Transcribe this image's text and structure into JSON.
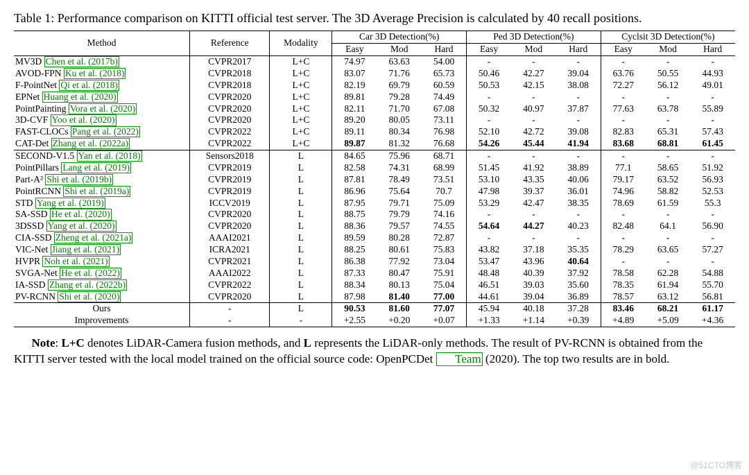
{
  "caption": "Table 1: Performance comparison on KITTI official test server. The 3D Average Precision is calculated by 40 recall positions.",
  "headers": {
    "method": "Method",
    "reference": "Reference",
    "modality": "Modality",
    "groups": [
      "Car 3D Detection(%)",
      "Ped 3D Detection(%)",
      "Cyclsit 3D Detection(%)"
    ],
    "sub": [
      "Easy",
      "Mod",
      "Hard"
    ]
  },
  "rows": [
    {
      "section": 0,
      "method": "MV3D",
      "cite": "Chen et al. (2017b)",
      "ref": "CVPR2017",
      "mod": "L+C",
      "v": [
        "74.97",
        "63.63",
        "54.00",
        "-",
        "-",
        "-",
        "-",
        "-",
        "-"
      ]
    },
    {
      "section": 0,
      "method": "AVOD-FPN",
      "cite": "Ku et al. (2018)",
      "ref": "CVPR2018",
      "mod": "L+C",
      "v": [
        "83.07",
        "71.76",
        "65.73",
        "50.46",
        "42.27",
        "39.04",
        "63.76",
        "50.55",
        "44.93"
      ]
    },
    {
      "section": 0,
      "method": "F-PointNet",
      "cite": "Qi et al. (2018)",
      "ref": "CVPR2018",
      "mod": "L+C",
      "v": [
        "82.19",
        "69.79",
        "60.59",
        "50.53",
        "42.15",
        "38.08",
        "72.27",
        "56.12",
        "49.01"
      ]
    },
    {
      "section": 0,
      "method": "EPNet",
      "cite": "Huang et al. (2020)",
      "ref": "CVPR2020",
      "mod": "L+C",
      "v": [
        "89.81",
        "79.28",
        "74.49",
        "-",
        "-",
        "-",
        "-",
        "-",
        "-"
      ]
    },
    {
      "section": 0,
      "method": "PointPainting",
      "cite": "Vora et al. (2020)",
      "ref": "CVPR2020",
      "mod": "L+C",
      "v": [
        "82.11",
        "71.70",
        "67.08",
        "50.32",
        "40.97",
        "37.87",
        "77.63",
        "63.78",
        "55.89"
      ]
    },
    {
      "section": 0,
      "method": "3D-CVF",
      "cite": "Yoo et al. (2020)",
      "ref": "CVPR2020",
      "mod": "L+C",
      "v": [
        "89.20",
        "80.05",
        "73.11",
        "-",
        "-",
        "-",
        "-",
        "-",
        "-"
      ]
    },
    {
      "section": 0,
      "method": "FAST-CLOCs",
      "cite": "Pang et al. (2022)",
      "ref": "CVPR2022",
      "mod": "L+C",
      "v": [
        "89.11",
        "80.34",
        "76.98",
        "52.10",
        "42.72",
        "39.08",
        "82.83",
        "65.31",
        "57.43"
      ]
    },
    {
      "section": 0,
      "method": "CAT-Det",
      "cite": "Zhang et al. (2022a)",
      "ref": "CVPR2022",
      "mod": "L+C",
      "v": [
        "89.87",
        "81.32",
        "76.68",
        "54.26",
        "45.44",
        "41.94",
        "83.68",
        "68.81",
        "61.45"
      ],
      "bold": [
        0,
        3,
        4,
        5,
        6,
        7,
        8
      ]
    },
    {
      "section": 1,
      "method": "SECOND-V1.5",
      "cite": "Yan et al. (2018)",
      "ref": "Sensors2018",
      "mod": "L",
      "v": [
        "84.65",
        "75.96",
        "68.71",
        "-",
        "-",
        "-",
        "-",
        "-",
        "-"
      ]
    },
    {
      "section": 1,
      "method": "PointPillars",
      "cite": "Lang et al. (2019)",
      "ref": "CVPR2019",
      "mod": "L",
      "v": [
        "82.58",
        "74.31",
        "68.99",
        "51.45",
        "41.92",
        "38.89",
        "77.1",
        "58.65",
        "51.92"
      ]
    },
    {
      "section": 1,
      "method": "Part-A²",
      "cite": "Shi et al. (2019b)",
      "ref": "CVPR2019",
      "mod": "L",
      "v": [
        "87.81",
        "78.49",
        "73.51",
        "53.10",
        "43.35",
        "40.06",
        "79.17",
        "63.52",
        "56.93"
      ]
    },
    {
      "section": 1,
      "method": "PointRCNN",
      "cite": "Shi et al. (2019a)",
      "ref": "CVPR2019",
      "mod": "L",
      "v": [
        "86.96",
        "75.64",
        "70.7",
        "47.98",
        "39.37",
        "36.01",
        "74.96",
        "58.82",
        "52.53"
      ]
    },
    {
      "section": 1,
      "method": "STD",
      "cite": "Yang et al. (2019)",
      "ref": "ICCV2019",
      "mod": "L",
      "v": [
        "87.95",
        "79.71",
        "75.09",
        "53.29",
        "42.47",
        "38.35",
        "78.69",
        "61.59",
        "55.3"
      ]
    },
    {
      "section": 1,
      "method": "SA-SSD",
      "cite": "He et al. (2020)",
      "ref": "CVPR2020",
      "mod": "L",
      "v": [
        "88.75",
        "79.79",
        "74.16",
        "-",
        "-",
        "-",
        "-",
        "-",
        "-"
      ]
    },
    {
      "section": 1,
      "method": "3DSSD",
      "cite": "Yang et al. (2020)",
      "ref": "CVPR2020",
      "mod": "L",
      "v": [
        "88.36",
        "79.57",
        "74.55",
        "54.64",
        "44.27",
        "40.23",
        "82.48",
        "64.1",
        "56.90"
      ],
      "bold": [
        3,
        4
      ]
    },
    {
      "section": 1,
      "method": "CIA-SSD",
      "cite": "Zheng et al. (2021a)",
      "ref": "AAAI2021",
      "mod": "L",
      "v": [
        "89.59",
        "80.28",
        "72.87",
        "-",
        "-",
        "-",
        "-",
        "-",
        "-"
      ]
    },
    {
      "section": 1,
      "method": "VIC-Net",
      "cite": "Jiang et al. (2021)",
      "ref": "ICRA2021",
      "mod": "L",
      "v": [
        "88.25",
        "80.61",
        "75.83",
        "43.82",
        "37.18",
        "35.35",
        "78.29",
        "63.65",
        "57.27"
      ]
    },
    {
      "section": 1,
      "method": "HVPR",
      "cite": "Noh et al. (2021)",
      "ref": "CVPR2021",
      "mod": "L",
      "v": [
        "86.38",
        "77.92",
        "73.04",
        "53.47",
        "43.96",
        "40.64",
        "-",
        "-",
        "-"
      ],
      "bold": [
        5
      ]
    },
    {
      "section": 1,
      "method": "SVGA-Net",
      "cite": "He et al. (2022)",
      "ref": "AAAI2022",
      "mod": "L",
      "v": [
        "87.33",
        "80.47",
        "75.91",
        "48.48",
        "40.39",
        "37.92",
        "78.58",
        "62.28",
        "54.88"
      ]
    },
    {
      "section": 1,
      "method": "IA-SSD",
      "cite": "Zhang et al. (2022b)",
      "ref": "CVPR2022",
      "mod": "L",
      "v": [
        "88.34",
        "80.13",
        "75.04",
        "46.51",
        "39.03",
        "35.60",
        "78.35",
        "61.94",
        "55.70"
      ]
    },
    {
      "section": 1,
      "method": "PV-RCNN",
      "cite": "Shi et al. (2020)",
      "ref": "CVPR2020",
      "mod": "L",
      "v": [
        "87.98",
        "81.40",
        "77.00",
        "44.61",
        "39.04",
        "36.89",
        "78.57",
        "63.12",
        "56.81"
      ],
      "bold": [
        1,
        2
      ]
    },
    {
      "section": 2,
      "method": "Ours",
      "ref": "-",
      "mod": "L",
      "v": [
        "90.53",
        "81.60",
        "77.07",
        "45.94",
        "40.18",
        "37.28",
        "83.46",
        "68.21",
        "61.17"
      ],
      "bold": [
        0,
        1,
        2,
        6,
        7,
        8
      ],
      "center": true
    },
    {
      "section": 2,
      "method": "Improvements",
      "ref": "-",
      "mod": "-",
      "v": [
        "+2.55",
        "+0.20",
        "+0.07",
        "+1.33",
        "+1.14",
        "+0.39",
        "+4.89",
        "+5.09",
        "+4.36"
      ],
      "center": true
    }
  ],
  "note_parts": {
    "prefix": "Note",
    "body1": ": ",
    "lc": "L+C",
    "body2": " denotes LiDAR-Camera fusion methods, and ",
    "l": "L",
    "body3": " represents the LiDAR-only methods. The result of PV-RCNN is obtained from the KITTI server tested with the local model trained on the official source code: OpenPCDet ",
    "cite": "Team",
    "year": " (2020)",
    "body4": ". The top two results are in bold."
  },
  "watermark": "@51CTO博客",
  "chart_data": {
    "type": "table",
    "title": "Performance comparison on KITTI official test server (3D AP, 40 recall positions)",
    "columns": [
      "Method",
      "Reference",
      "Modality",
      "Car-Easy",
      "Car-Mod",
      "Car-Hard",
      "Ped-Easy",
      "Ped-Mod",
      "Ped-Hard",
      "Cyc-Easy",
      "Cyc-Mod",
      "Cyc-Hard"
    ],
    "rows": [
      [
        "MV3D",
        "CVPR2017",
        "L+C",
        74.97,
        63.63,
        54.0,
        null,
        null,
        null,
        null,
        null,
        null
      ],
      [
        "AVOD-FPN",
        "CVPR2018",
        "L+C",
        83.07,
        71.76,
        65.73,
        50.46,
        42.27,
        39.04,
        63.76,
        50.55,
        44.93
      ],
      [
        "F-PointNet",
        "CVPR2018",
        "L+C",
        82.19,
        69.79,
        60.59,
        50.53,
        42.15,
        38.08,
        72.27,
        56.12,
        49.01
      ],
      [
        "EPNet",
        "CVPR2020",
        "L+C",
        89.81,
        79.28,
        74.49,
        null,
        null,
        null,
        null,
        null,
        null
      ],
      [
        "PointPainting",
        "CVPR2020",
        "L+C",
        82.11,
        71.7,
        67.08,
        50.32,
        40.97,
        37.87,
        77.63,
        63.78,
        55.89
      ],
      [
        "3D-CVF",
        "CVPR2020",
        "L+C",
        89.2,
        80.05,
        73.11,
        null,
        null,
        null,
        null,
        null,
        null
      ],
      [
        "FAST-CLOCs",
        "CVPR2022",
        "L+C",
        89.11,
        80.34,
        76.98,
        52.1,
        42.72,
        39.08,
        82.83,
        65.31,
        57.43
      ],
      [
        "CAT-Det",
        "CVPR2022",
        "L+C",
        89.87,
        81.32,
        76.68,
        54.26,
        45.44,
        41.94,
        83.68,
        68.81,
        61.45
      ],
      [
        "SECOND-V1.5",
        "Sensors2018",
        "L",
        84.65,
        75.96,
        68.71,
        null,
        null,
        null,
        null,
        null,
        null
      ],
      [
        "PointPillars",
        "CVPR2019",
        "L",
        82.58,
        74.31,
        68.99,
        51.45,
        41.92,
        38.89,
        77.1,
        58.65,
        51.92
      ],
      [
        "Part-A2",
        "CVPR2019",
        "L",
        87.81,
        78.49,
        73.51,
        53.1,
        43.35,
        40.06,
        79.17,
        63.52,
        56.93
      ],
      [
        "PointRCNN",
        "CVPR2019",
        "L",
        86.96,
        75.64,
        70.7,
        47.98,
        39.37,
        36.01,
        74.96,
        58.82,
        52.53
      ],
      [
        "STD",
        "ICCV2019",
        "L",
        87.95,
        79.71,
        75.09,
        53.29,
        42.47,
        38.35,
        78.69,
        61.59,
        55.3
      ],
      [
        "SA-SSD",
        "CVPR2020",
        "L",
        88.75,
        79.79,
        74.16,
        null,
        null,
        null,
        null,
        null,
        null
      ],
      [
        "3DSSD",
        "CVPR2020",
        "L",
        88.36,
        79.57,
        74.55,
        54.64,
        44.27,
        40.23,
        82.48,
        64.1,
        56.9
      ],
      [
        "CIA-SSD",
        "AAAI2021",
        "L",
        89.59,
        80.28,
        72.87,
        null,
        null,
        null,
        null,
        null,
        null
      ],
      [
        "VIC-Net",
        "ICRA2021",
        "L",
        88.25,
        80.61,
        75.83,
        43.82,
        37.18,
        35.35,
        78.29,
        63.65,
        57.27
      ],
      [
        "HVPR",
        "CVPR2021",
        "L",
        86.38,
        77.92,
        73.04,
        53.47,
        43.96,
        40.64,
        null,
        null,
        null
      ],
      [
        "SVGA-Net",
        "AAAI2022",
        "L",
        87.33,
        80.47,
        75.91,
        48.48,
        40.39,
        37.92,
        78.58,
        62.28,
        54.88
      ],
      [
        "IA-SSD",
        "CVPR2022",
        "L",
        88.34,
        80.13,
        75.04,
        46.51,
        39.03,
        35.6,
        78.35,
        61.94,
        55.7
      ],
      [
        "PV-RCNN",
        "CVPR2020",
        "L",
        87.98,
        81.4,
        77.0,
        44.61,
        39.04,
        36.89,
        78.57,
        63.12,
        56.81
      ],
      [
        "Ours",
        "-",
        "L",
        90.53,
        81.6,
        77.07,
        45.94,
        40.18,
        37.28,
        83.46,
        68.21,
        61.17
      ],
      [
        "Improvements",
        "-",
        "-",
        2.55,
        0.2,
        0.07,
        1.33,
        1.14,
        0.39,
        4.89,
        5.09,
        4.36
      ]
    ]
  }
}
